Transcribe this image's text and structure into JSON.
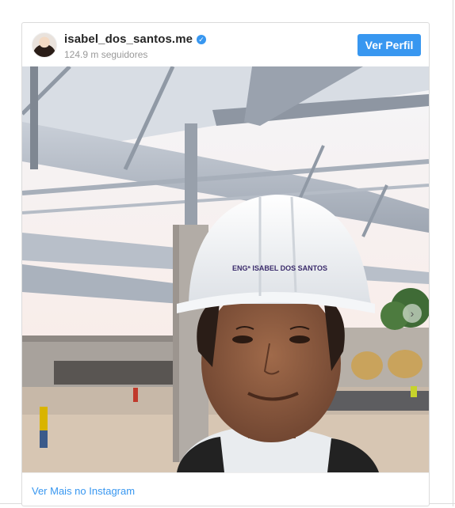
{
  "post": {
    "username": "isabel_dos_santos.me",
    "followers": "124.9 m seguidores",
    "view_profile_label": "Ver Perfil",
    "more_link_label": "Ver Mais no Instagram",
    "helmet_text": "ENGª ISABEL DOS SANTOS"
  },
  "icons": {
    "verified": "verified-badge-icon",
    "next": "chevron-right-icon"
  },
  "colors": {
    "accent": "#3897f0",
    "text": "#262626",
    "muted": "#999999",
    "border": "#dbdbdb"
  }
}
